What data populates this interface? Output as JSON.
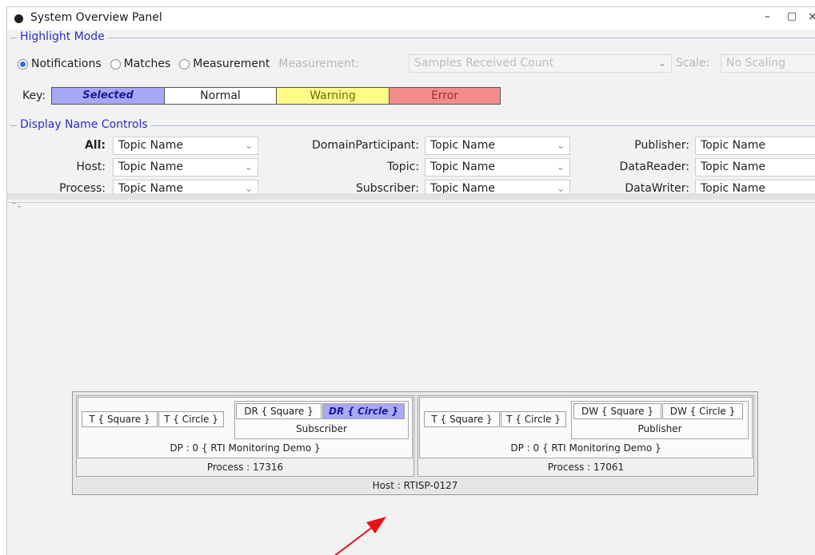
{
  "window": {
    "title": "System Overview Panel",
    "controls": {
      "minimize": "–",
      "restore": "▢",
      "close": "×"
    }
  },
  "highlight_mode": {
    "title": "Highlight Mode",
    "options": [
      "Notifications",
      "Matches",
      "Measurement"
    ],
    "selected": "Notifications",
    "measurement_label": "Measurement:",
    "measurement_value": "Samples Received Count",
    "scale_label": "Scale:",
    "scale_value": "No Scaling",
    "key_label": "Key:",
    "keys": [
      {
        "label": "Selected",
        "color": "#a6a8f5"
      },
      {
        "label": "Normal",
        "color": "#ffffff"
      },
      {
        "label": "Warning",
        "color": "#fbfb86"
      },
      {
        "label": "Error",
        "color": "#f38b8b"
      }
    ]
  },
  "display_name_controls": {
    "title": "Display Name Controls",
    "fields": [
      {
        "label": "All:",
        "value": "Topic Name"
      },
      {
        "label": "Host:",
        "value": "Topic Name"
      },
      {
        "label": "Process:",
        "value": "Topic Name"
      },
      {
        "label": "DomainParticipant:",
        "value": "Topic Name"
      },
      {
        "label": "Topic:",
        "value": "Topic Name"
      },
      {
        "label": "Subscriber:",
        "value": "Topic Name"
      },
      {
        "label": "Publisher:",
        "value": "Topic Name"
      },
      {
        "label": "DataReader:",
        "value": "Topic Name"
      },
      {
        "label": "DataWriter:",
        "value": "Topic Name"
      }
    ]
  },
  "overview": {
    "host": "Host : RTISP-0127",
    "processes": [
      {
        "label": "Process : 17316",
        "participant": "DP : 0 { RTI Monitoring Demo }",
        "topics": [
          "T { Square }",
          "T { Circle }"
        ],
        "entity_group": "Subscriber",
        "entities": [
          "DR { Square }",
          "DR { Circle }"
        ],
        "selected_entity": "DR { Circle }"
      },
      {
        "label": "Process : 17061",
        "participant": "DP : 0 { RTI Monitoring Demo }",
        "topics": [
          "T { Square }",
          "T { Circle }"
        ],
        "entity_group": "Publisher",
        "entities": [
          "DW { Square }",
          "DW { Circle }"
        ],
        "selected_entity": ""
      }
    ]
  },
  "annotation": {
    "arrow_color": "#e8101a"
  }
}
